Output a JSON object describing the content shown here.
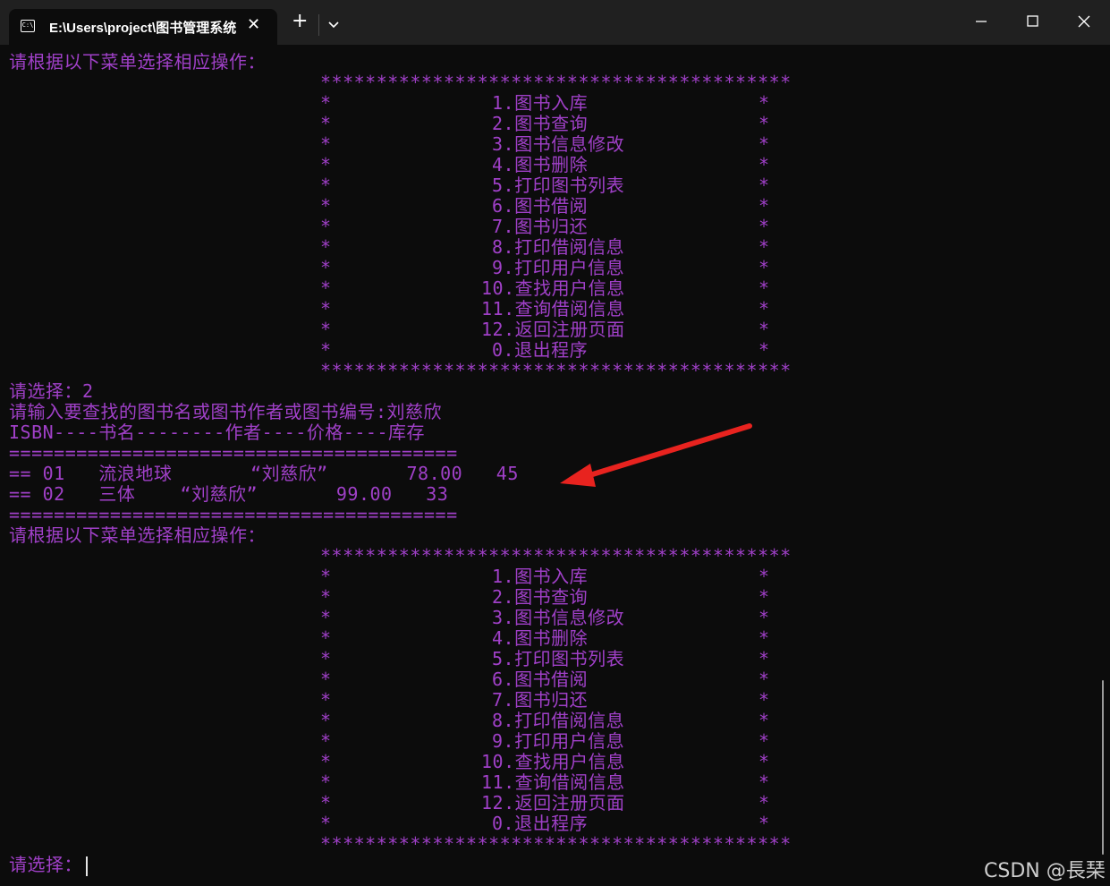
{
  "window": {
    "tab_title": "E:\\Users\\project\\图书管理系统",
    "icon_text": "C:\\",
    "close_tab": "✕",
    "new_tab": "+"
  },
  "terminal": {
    "prompt_menu": "请根据以下菜单选择相应操作：",
    "stars": "******************************************",
    "star": "*",
    "menu_items": [
      "1.图书入库",
      "2.图书查询",
      "3.图书信息修改",
      "4.图书删除",
      "5.打印图书列表",
      "6.图书借阅",
      "7.图书归还",
      "8.打印借阅信息",
      "9.打印用户信息",
      "10.查找用户信息",
      "11.查询借阅信息",
      "12.返回注册页面",
      "0.退出程序"
    ],
    "choice_line": "请选择：2",
    "search_prompt": "请输入要查找的图书名或图书作者或图书编号:刘慈欣",
    "header_line": "ISBN----书名--------作者----价格----库存",
    "divider": "========================================",
    "result_rows": [
      "== 01   流浪地球       “刘慈欣”       78.00   45",
      "== 02   三体    “刘慈欣”       99.00   33"
    ],
    "final_prompt": "请选择："
  },
  "annotation": {
    "arrow_color": "#e8231f"
  },
  "watermark": "CSDN @長琹"
}
